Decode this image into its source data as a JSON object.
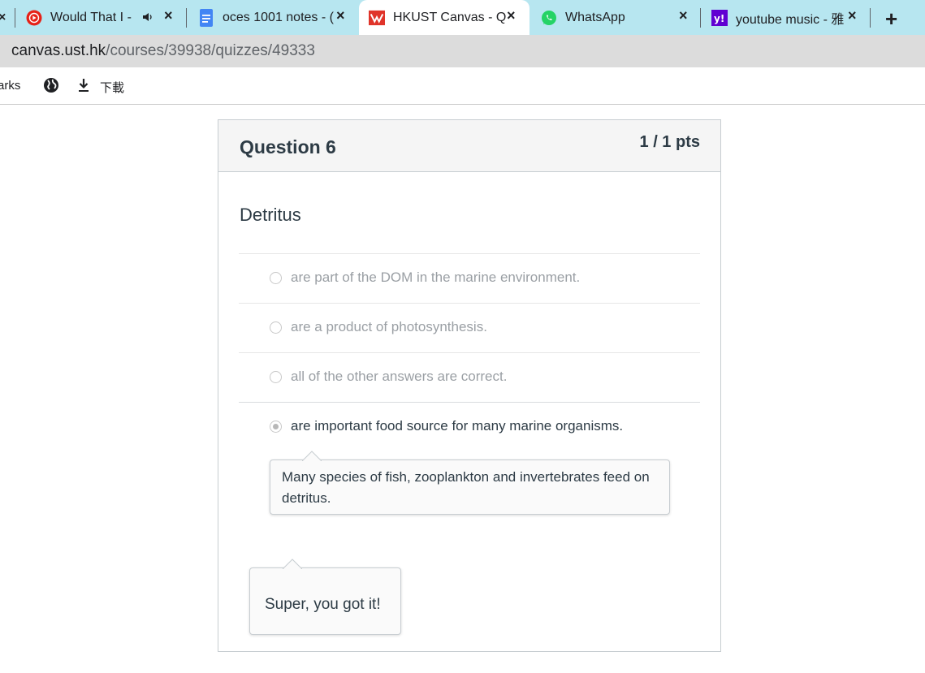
{
  "browser": {
    "tabs": [
      {
        "title": "Would That I -",
        "icon": "youtube-music-icon",
        "audio": true
      },
      {
        "title": "oces 1001 notes - (",
        "icon": "google-docs-icon"
      },
      {
        "title": "HKUST Canvas - Q",
        "icon": "canvas-icon",
        "active": true
      },
      {
        "title": "WhatsApp",
        "icon": "whatsapp-icon"
      },
      {
        "title": "youtube music - 雅",
        "icon": "yahoo-icon"
      }
    ],
    "url_domain": "canvas.ust.hk",
    "url_path": "/courses/39938/quizzes/49333",
    "bookmarks": {
      "partial_label": "arks",
      "download_label": "下載"
    }
  },
  "quiz": {
    "question_title": "Question 6",
    "points": "1 / 1 pts",
    "question_text": "Detritus",
    "answers": [
      {
        "text": "are part of the DOM in the marine environment.",
        "selected": false
      },
      {
        "text": "are a product of photosynthesis.",
        "selected": false
      },
      {
        "text": "all of the other answers are correct.",
        "selected": false
      },
      {
        "text": "are important food source for many marine organisms.",
        "selected": true
      }
    ],
    "answer_comment": "Many species of fish, zooplankton and invertebrates feed on detritus.",
    "correct_feedback": "Super, you got it!"
  },
  "colors": {
    "tabstrip": "#b7e6f0",
    "text": "#2d3b45",
    "muted_answer": "#9a9fa4"
  }
}
